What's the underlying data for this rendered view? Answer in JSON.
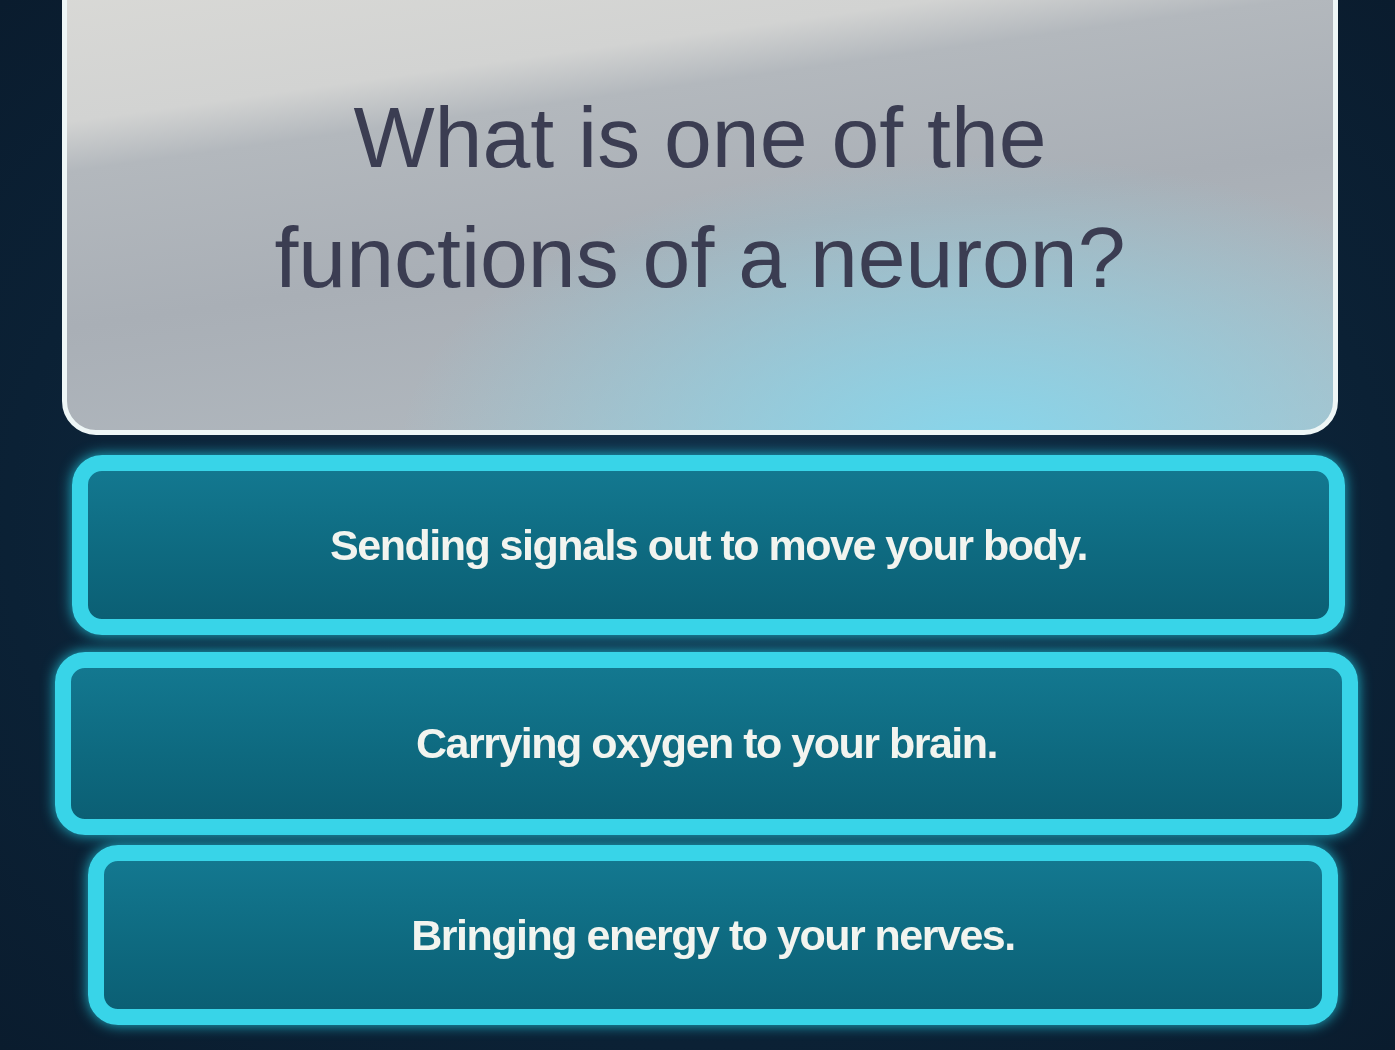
{
  "question": {
    "text": "What is one of the functions of a neuron?"
  },
  "answers": [
    {
      "label": "Sending signals out to move your body."
    },
    {
      "label": "Carrying oxygen to your brain."
    },
    {
      "label": "Bringing energy to your nerves."
    }
  ]
}
